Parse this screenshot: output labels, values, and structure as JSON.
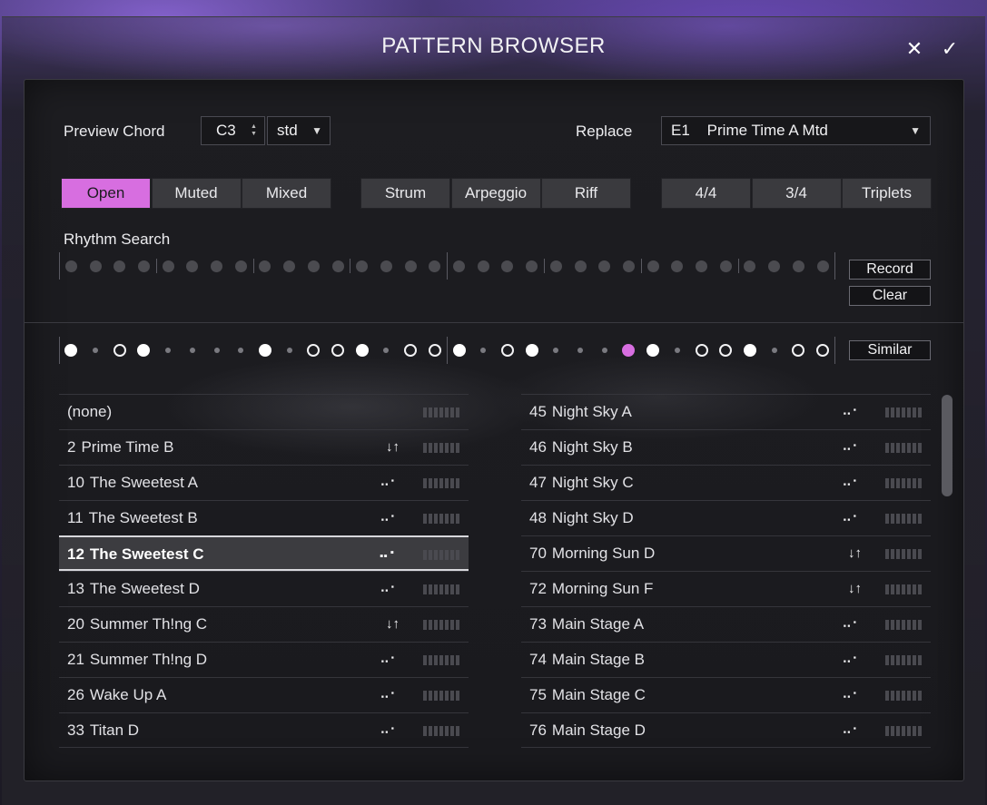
{
  "window": {
    "title": "PATTERN BROWSER",
    "close_glyph": "✕",
    "confirm_glyph": "✓"
  },
  "preview": {
    "label": "Preview Chord",
    "chord": "C3",
    "stepper_glyph": "▲▼",
    "voicing": "std",
    "dropdown_glyph": "▼"
  },
  "replace": {
    "label": "Replace",
    "value": "E1    Prime Time A Mtd",
    "dropdown_glyph": "▼"
  },
  "mute_modes": [
    {
      "label": "Open",
      "active": true
    },
    {
      "label": "Muted",
      "active": false
    },
    {
      "label": "Mixed",
      "active": false
    }
  ],
  "play_styles": [
    {
      "label": "Strum",
      "active": false
    },
    {
      "label": "Arpeggio",
      "active": false
    },
    {
      "label": "Riff",
      "active": false
    }
  ],
  "time_signatures": [
    {
      "label": "4/4",
      "active": false
    },
    {
      "label": "3/4",
      "active": false
    },
    {
      "label": "Triplets",
      "active": false
    }
  ],
  "rhythm_search": {
    "label": "Rhythm Search",
    "record_label": "Record",
    "clear_label": "Clear",
    "step_count": 32
  },
  "pattern": {
    "similar_label": "Similar",
    "steps": [
      "big",
      "small",
      "ring",
      "big",
      "small",
      "small",
      "small",
      "small",
      "big",
      "small",
      "ring",
      "ring",
      "big",
      "small",
      "ring",
      "ring",
      "big",
      "small",
      "ring",
      "big",
      "small",
      "small",
      "small",
      "pink",
      "big",
      "small",
      "ring",
      "ring",
      "big",
      "small",
      "ring",
      "ring"
    ]
  },
  "icons": {
    "strum": "↓↑",
    "arp": "⠤⠂"
  },
  "colors": {
    "accent": "#d76ee0",
    "button_bg": "#3a3a3e",
    "panel_bg": "#1d1d21"
  },
  "left_list": [
    {
      "num": "",
      "name": "(none)",
      "icon": ""
    },
    {
      "num": "2",
      "name": "Prime Time B",
      "icon": "strum"
    },
    {
      "num": "10",
      "name": "The Sweetest A",
      "icon": "arp"
    },
    {
      "num": "11",
      "name": "The Sweetest B",
      "icon": "arp"
    },
    {
      "num": "12",
      "name": "The Sweetest C",
      "icon": "arp",
      "selected": true
    },
    {
      "num": "13",
      "name": "The Sweetest D",
      "icon": "arp"
    },
    {
      "num": "20",
      "name": "Summer Th!ng C",
      "icon": "strum"
    },
    {
      "num": "21",
      "name": "Summer Th!ng D",
      "icon": "arp"
    },
    {
      "num": "26",
      "name": "Wake Up A",
      "icon": "arp"
    },
    {
      "num": "33",
      "name": "Titan D",
      "icon": "arp"
    }
  ],
  "right_list": [
    {
      "num": "45",
      "name": "Night Sky A",
      "icon": "arp"
    },
    {
      "num": "46",
      "name": "Night Sky B",
      "icon": "arp"
    },
    {
      "num": "47",
      "name": "Night Sky C",
      "icon": "arp"
    },
    {
      "num": "48",
      "name": "Night Sky D",
      "icon": "arp"
    },
    {
      "num": "70",
      "name": "Morning Sun D",
      "icon": "strum"
    },
    {
      "num": "72",
      "name": "Morning Sun F",
      "icon": "strum"
    },
    {
      "num": "73",
      "name": "Main Stage A",
      "icon": "arp"
    },
    {
      "num": "74",
      "name": "Main Stage B",
      "icon": "arp"
    },
    {
      "num": "75",
      "name": "Main Stage C",
      "icon": "arp"
    },
    {
      "num": "76",
      "name": "Main Stage D",
      "icon": "arp"
    }
  ]
}
